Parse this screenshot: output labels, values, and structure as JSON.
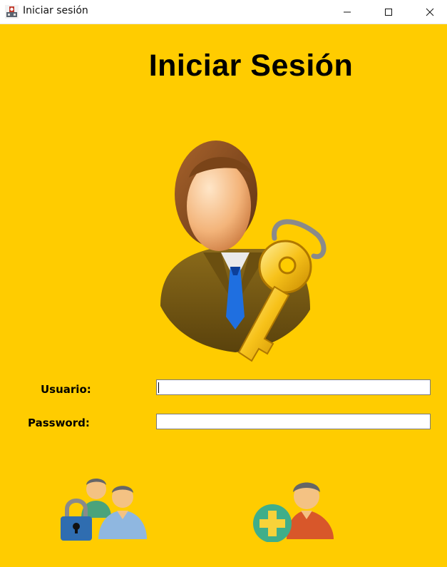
{
  "window": {
    "title": "Iniciar sesión",
    "controls": [
      "minimize",
      "maximize",
      "close"
    ]
  },
  "form": {
    "heading": "Iniciar Sesión",
    "username_label": "Usuario:",
    "username_value": "",
    "password_label": "Password:",
    "password_value": ""
  },
  "icons": {
    "hero": "user-key-icon",
    "login_button": "users-lock-icon",
    "register_button": "add-user-icon"
  },
  "colors": {
    "background": "#ffcc00",
    "heading": "#000000"
  }
}
